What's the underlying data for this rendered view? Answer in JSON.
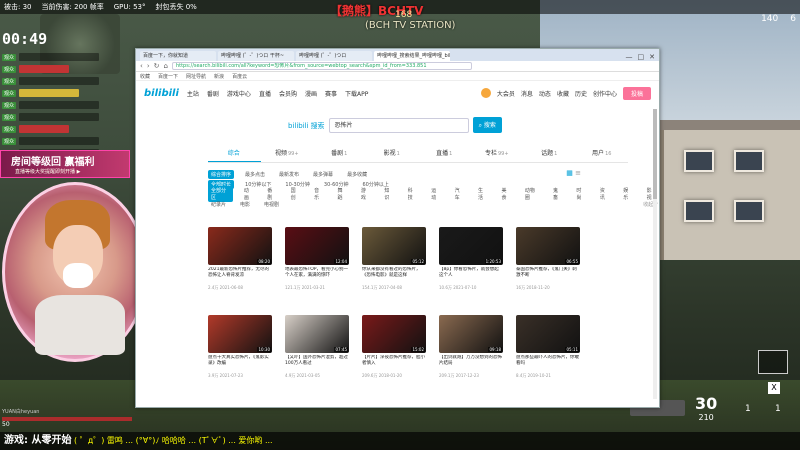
{
  "hud": {
    "kills_label": "被击:",
    "kills": "30",
    "damage_label": "当前伤害:",
    "damage": "200 帧率",
    "gpu_label": "GPU:",
    "gpu": "53°",
    "status": "封包丢失 0%",
    "timer": "00:49",
    "stream_title": "【鹅熊】BCHTV",
    "stream_num": "168",
    "stream_sub": "(BCH TV STATION)",
    "banner_title": "房间等级回 赢福利",
    "banner_sub": "直播等级大奖提醒即刻开播 ▶",
    "player_name": "YUAN白heyuan",
    "hp": "50",
    "ammo": "30",
    "ammo_reserve": "210",
    "top_right_a": "140",
    "top_right_b": "6",
    "slot_a": "1",
    "slot_b": "1",
    "x_key": "X",
    "ticker_lead": "游戏: 从零开始",
    "ticker": "( ゜д゜) 雷鸣 ... (°∀°)ﾉ 哈哈哈 ... (Tﾟ∀ﾟ) ... 爱你哟 ...",
    "chat": [
      {
        "tag": "观众"
      },
      {
        "tag": "观众"
      },
      {
        "tag": "观众"
      },
      {
        "tag": "观众"
      },
      {
        "tag": "观众"
      },
      {
        "tag": "观众"
      },
      {
        "tag": "观众"
      },
      {
        "tag": "观众"
      },
      {
        "tag": "观众"
      }
    ]
  },
  "browser": {
    "tabs": [
      "百度一下，你就知道",
      "哔哩哔哩 (゜-゜)つロ 干杯~",
      "哔哩哔哩 (゜-゜)つロ",
      "哔哩哔哩_搜索结果_哔哩哔哩_bilibili"
    ],
    "address": "https://search.bilibili.com/all?keyword=恐怖片&from_source=webtop_search&spm_id_from=333.851",
    "favorites": [
      "收藏",
      "百度一下",
      "网址导航",
      "新浪",
      "百度云"
    ]
  },
  "bili": {
    "logo": "bilibili",
    "nav": [
      "主站",
      "番剧",
      "游戏中心",
      "直播",
      "会员购",
      "漫画",
      "赛事",
      "下载APP"
    ],
    "user_menu": [
      "大会员",
      "消息",
      "动态",
      "收藏",
      "历史",
      "创作中心"
    ],
    "submit": "投稿",
    "search_logo_suffix": "搜索",
    "search_value": "恐怖片",
    "search_button": "搜索",
    "type_tabs": [
      {
        "label": "综合",
        "count": ""
      },
      {
        "label": "视频",
        "count": "99+"
      },
      {
        "label": "番剧",
        "count": "1"
      },
      {
        "label": "影视",
        "count": "1"
      },
      {
        "label": "直播",
        "count": "1"
      },
      {
        "label": "专栏",
        "count": "99+"
      },
      {
        "label": "话题",
        "count": "1"
      },
      {
        "label": "用户",
        "count": "16"
      }
    ],
    "sort_row": [
      "综合排序",
      "最多点击",
      "最新发布",
      "最多弹幕",
      "最多收藏"
    ],
    "duration_row": [
      "全部时长",
      "10分钟以下",
      "10-30分钟",
      "30-60分钟",
      "60分钟以上"
    ],
    "zone_row": [
      "全部分区",
      "动画",
      "番剧",
      "国创",
      "音乐",
      "舞蹈",
      "游戏",
      "知识",
      "科技",
      "运动",
      "汽车",
      "生活",
      "美食",
      "动物圈",
      "鬼畜",
      "时尚",
      "资讯",
      "娱乐",
      "影视"
    ],
    "zone_row2": [
      "纪录片",
      "电影",
      "电视剧"
    ],
    "fold": "收起 ⌃",
    "videos": [
      {
        "title": "2021最新恐怖片推荐，无尽的恐怖让人脊背发凉",
        "views": "2.4万",
        "date": "2021-06-08",
        "dur": "08:20",
        "color": "#8a2a1c"
      },
      {
        "title": "地表最恐怖TOP，看完小心别一个人在家，满满的惊吓",
        "views": "121.1万",
        "date": "2021-03-21",
        "dur": "12:04",
        "color": "#5a0e14"
      },
      {
        "title": "你从来都没有看过的恐怖片，《恐怖电影》就是这样",
        "views": "154.1万",
        "date": "2017-04-08",
        "dur": "05:12",
        "color": "#6b5a3a"
      },
      {
        "title": "【8p】你看恐怖片，就会想起这个人",
        "views": "10.6万",
        "date": "2021-07-10",
        "dur": "1:20:53",
        "color": "#1a1a1a"
      },
      {
        "title": "泰国恐怖片推荐，《鬼门关》刺激不断",
        "views": "16万",
        "date": "2018-11-20",
        "dur": "06:55",
        "color": "#4a3a2a"
      },
      {
        "title": "盘点十大真实恐怖片，《鬼影实录》改编",
        "views": "3.9万",
        "date": "2021-07-23",
        "dur": "10:30",
        "color": "#b23a2a"
      },
      {
        "title": "【又吓】国外恐怖片混剪，超过100万人看过",
        "views": "4.9万",
        "date": "2021-03-05",
        "dur": "07:45",
        "color": "#d8d0c8"
      },
      {
        "title": "【片片】深夜恐怖片推荐，胆小者慎入",
        "views": "209.6万",
        "date": "2018-01-20",
        "dur": "15:02",
        "color": "#7a1a1a"
      },
      {
        "title": "【出剑就跑】万万没想到的恐怖片结局",
        "views": "209.1万",
        "date": "2017-12-23",
        "dur": "09:18",
        "color": "#8a6a50"
      },
      {
        "title": "盘点那些最吓人的恐怖片，你敢看吗",
        "views": "8.4万",
        "date": "2019-10-21",
        "dur": "05:11",
        "color": "#3a3028"
      }
    ]
  }
}
